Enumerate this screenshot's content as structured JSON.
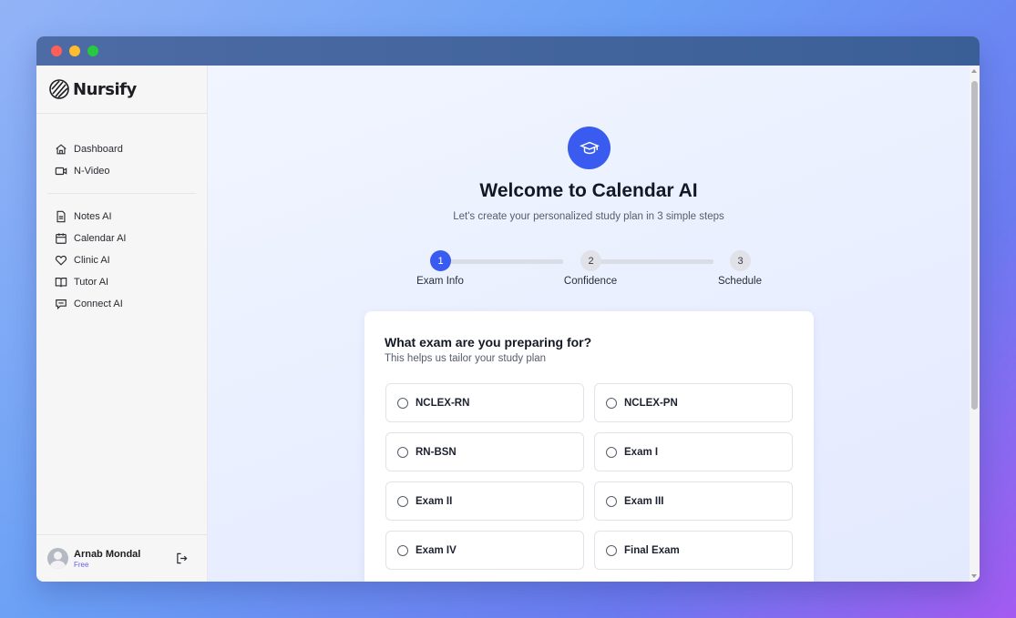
{
  "app": {
    "name": "Nursify"
  },
  "sidebar": {
    "primary": [
      {
        "label": "Dashboard",
        "icon": "home-icon"
      },
      {
        "label": "N-Video",
        "icon": "video-icon"
      }
    ],
    "tools": [
      {
        "label": "Notes AI",
        "icon": "file-icon"
      },
      {
        "label": "Calendar AI",
        "icon": "calendar-icon"
      },
      {
        "label": "Clinic AI",
        "icon": "heart-icon"
      },
      {
        "label": "Tutor AI",
        "icon": "book-icon"
      },
      {
        "label": "Connect AI",
        "icon": "chat-icon"
      }
    ],
    "user": {
      "name": "Arnab Mondal",
      "plan": "Free"
    }
  },
  "main": {
    "hero_icon": "graduation-cap-icon",
    "title": "Welcome to Calendar AI",
    "subtitle": "Let's create your personalized study plan in 3 simple steps",
    "steps": [
      {
        "number": "1",
        "label": "Exam Info",
        "state": "active"
      },
      {
        "number": "2",
        "label": "Confidence",
        "state": "pending"
      },
      {
        "number": "3",
        "label": "Schedule",
        "state": "pending"
      }
    ],
    "card": {
      "question": "What exam are you preparing for?",
      "helper": "This helps us tailor your study plan",
      "options": [
        "NCLEX-RN",
        "NCLEX-PN",
        "RN-BSN",
        "Exam I",
        "Exam II",
        "Exam III",
        "Exam IV",
        "Final Exam"
      ]
    }
  },
  "colors": {
    "accent": "#3a5bf0",
    "plan": "#6a5cf0"
  }
}
